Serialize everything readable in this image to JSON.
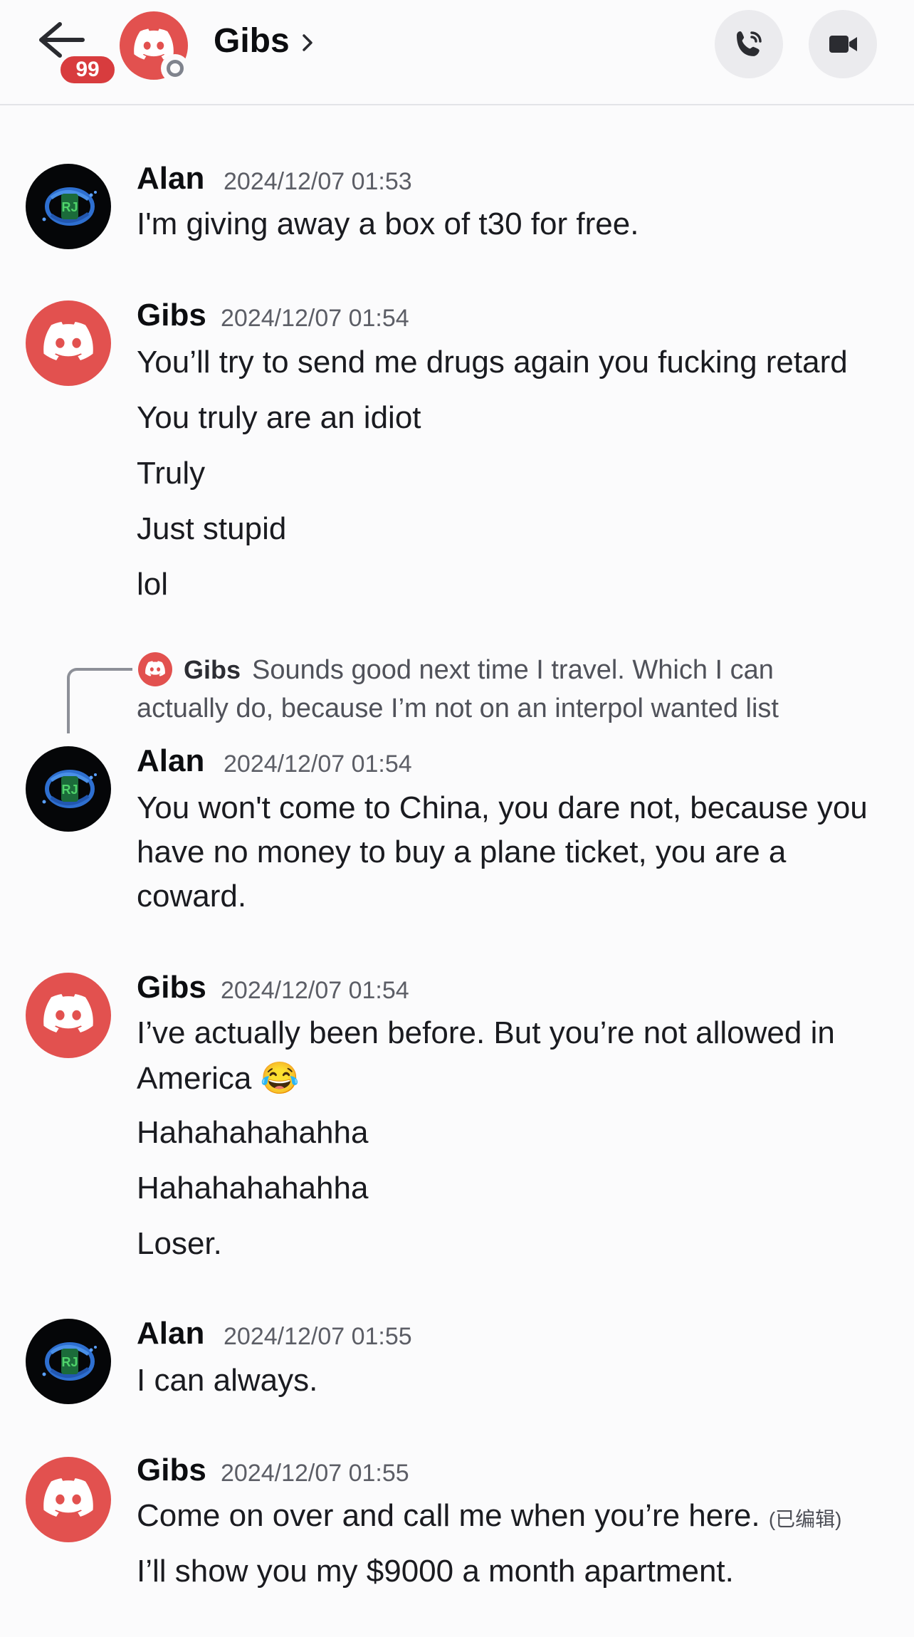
{
  "header": {
    "unread_count": "99",
    "channel_name": "Gibs",
    "icons": {
      "back": "arrow-left-icon",
      "chevron": "chevron-right-icon",
      "call": "phone-icon",
      "video": "video-camera-icon"
    },
    "colors": {
      "discord_red": "#e2514f",
      "badge_red": "#d83c3e"
    }
  },
  "messages": [
    {
      "author": "Alan",
      "timestamp": "2024/12/07 01:53",
      "lines": [
        "I'm giving away a box of t30 for free."
      ]
    },
    {
      "author": "Gibs",
      "timestamp": "2024/12/07 01:54",
      "lines": [
        "You’ll try to send me drugs again you fucking retard",
        "You truly are an idiot",
        "Truly",
        "Just stupid",
        "lol"
      ]
    },
    {
      "author": "Alan",
      "timestamp": "2024/12/07 01:54",
      "reply": {
        "author": "Gibs",
        "text_line1": "Sounds good next time I travel. Which I can",
        "text_line2": "actually do, because I’m not on an interpol wanted list"
      },
      "lines": [
        "You won't come to China, you dare not, because you",
        "have no money to buy a plane ticket, you are a",
        "coward."
      ]
    },
    {
      "author": "Gibs",
      "timestamp": "2024/12/07 01:54",
      "lines": [
        "I’ve actually been before. But you’re not allowed in",
        "America",
        "Hahahahahahha",
        "Hahahahahahha",
        "Loser."
      ],
      "emoji": "😂"
    },
    {
      "author": "Alan",
      "timestamp": "2024/12/07 01:55",
      "lines": [
        "I can always."
      ]
    },
    {
      "author": "Gibs",
      "timestamp": "2024/12/07 01:55",
      "lines": [
        "Come on over and call me when you’re here.",
        "I’ll show you my $9000 a month apartment."
      ],
      "edited_label": "(已编辑)"
    }
  ]
}
